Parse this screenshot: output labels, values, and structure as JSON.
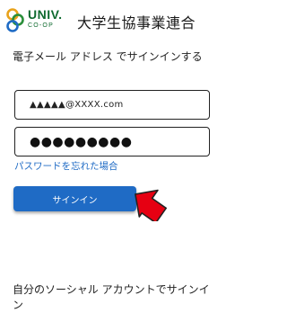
{
  "header": {
    "logo_univ": "UNIV.",
    "logo_coop": "CO-OP",
    "org_name": "大学生協事業連合"
  },
  "login": {
    "email_label": "電子メール アドレス でサインインする",
    "email_value": "▲▲▲▲▲@XXXX.com",
    "password_value": "●●●●●●●●●",
    "forgot_password_link": "パスワードを忘れた場合",
    "signin_button": "サインイン"
  },
  "social": {
    "label": "自分のソーシャル アカウントでサインイン"
  },
  "icons": {
    "logo": "univ-coop-logo-icon",
    "annotation_arrow": "red-arrow-icon"
  },
  "colors": {
    "brand_green": "#0f6a2f",
    "primary_blue": "#1f6bc5",
    "arrow_red": "#e60012"
  }
}
